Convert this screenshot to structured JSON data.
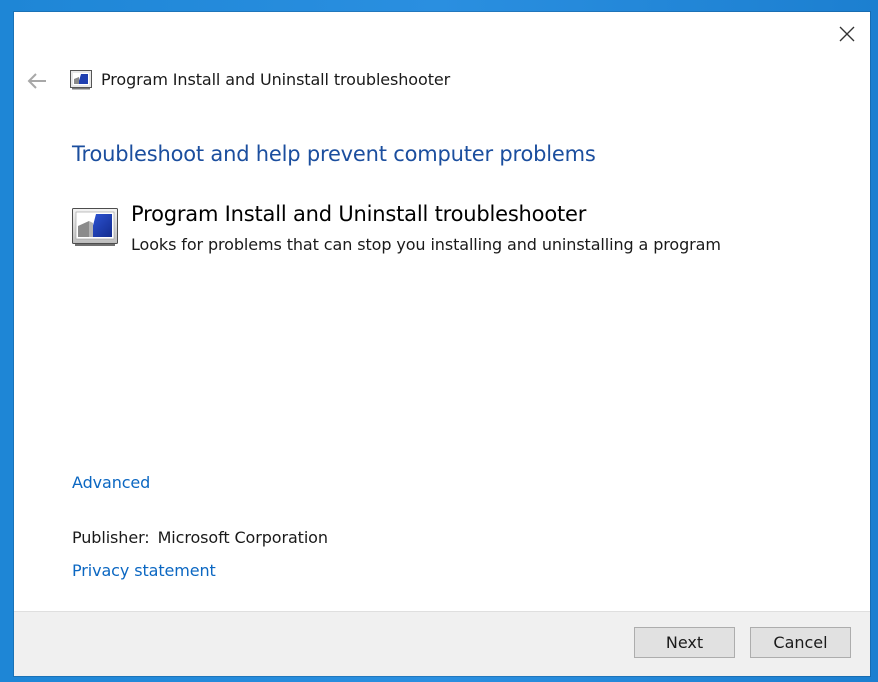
{
  "window": {
    "title": "Program Install and Uninstall troubleshooter"
  },
  "icons": {
    "back": "back-arrow-icon",
    "close": "close-icon",
    "title": "troubleshooter-icon",
    "troubleshooter": "troubleshooter-icon"
  },
  "main": {
    "heading": "Troubleshoot and help prevent computer problems",
    "troubleshooter": {
      "title": "Program Install and Uninstall troubleshooter",
      "description": "Looks for problems that can stop you installing and uninstalling a program"
    },
    "advanced_link": "Advanced",
    "publisher_label": "Publisher:",
    "publisher_value": "Microsoft Corporation",
    "privacy_link": "Privacy statement"
  },
  "footer": {
    "next_label": "Next",
    "cancel_label": "Cancel"
  },
  "colors": {
    "heading": "#1b4e9e",
    "link": "#0b67c2",
    "desktop": "#1e86d6",
    "footer": "#f0f0f0"
  }
}
